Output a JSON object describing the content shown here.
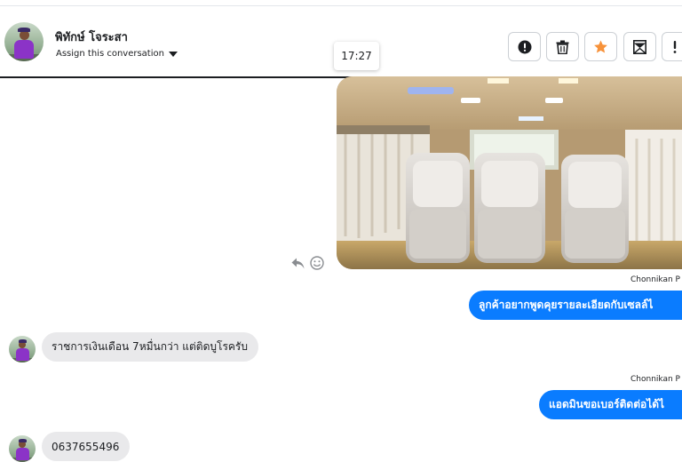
{
  "header": {
    "user_name": "พิทักษ์ โจระสา",
    "assign_label": "Assign this conversation",
    "timestamp_tooltip": "17:27",
    "actions": [
      {
        "name": "report",
        "icon": "alert-circle-icon"
      },
      {
        "name": "delete",
        "icon": "trash-icon"
      },
      {
        "name": "star",
        "icon": "star-icon",
        "color": "#f7923a"
      },
      {
        "name": "archive",
        "icon": "archive-box-icon"
      },
      {
        "name": "more",
        "icon": "exclamation-icon"
      }
    ]
  },
  "messages": [
    {
      "type": "image",
      "direction": "out",
      "description_icon": "van-interior-photo"
    },
    {
      "type": "text",
      "direction": "out",
      "sender": "Chonnikan P",
      "text": "ลูกค้าอยากพูดคุยรายละเอียดกับเซลล์ไ"
    },
    {
      "type": "text",
      "direction": "in",
      "text": "ราชการเงินเดือน 7หมื่นกว่า แต่ติดบูโรครับ"
    },
    {
      "type": "text",
      "direction": "out",
      "sender": "Chonnikan P",
      "text": "แอดมินขอเบอร์ติดต่อได้ไ"
    },
    {
      "type": "text",
      "direction": "in",
      "text": "0637655496"
    }
  ],
  "colors": {
    "outgoing_bubble": "#0a7cff",
    "incoming_bubble": "#e9e9eb",
    "star": "#f7923a"
  }
}
